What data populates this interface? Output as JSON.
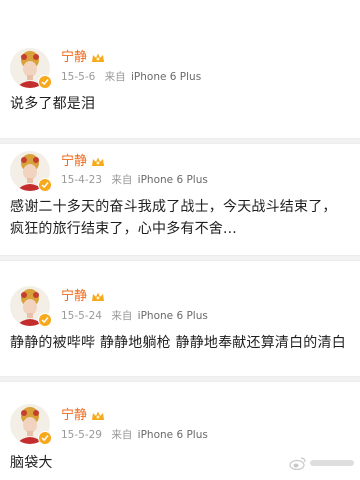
{
  "posts": [
    {
      "name": "宁静",
      "date": "15-5-6",
      "source_prefix": "来自",
      "device": "iPhone 6 Plus",
      "text": "说多了都是泪"
    },
    {
      "name": "宁静",
      "date": "15-4-23",
      "source_prefix": "来自",
      "device": "iPhone 6 Plus",
      "text": "感谢二十多天的奋斗我成了战士，今天战斗结束了，疯狂的旅行结束了，心中多有不舍..."
    },
    {
      "name": "宁静",
      "date": "15-5-24",
      "source_prefix": "来自",
      "device": "iPhone 6 Plus",
      "text": "静静的被哔哔 静静地躺枪 静静地奉献还算清白的清白"
    },
    {
      "name": "宁静",
      "date": "15-5-29",
      "source_prefix": "来自",
      "device": "iPhone 6 Plus",
      "text": "脑袋大"
    }
  ],
  "colors": {
    "name": "#f26a1b",
    "badge": "#f7a81b",
    "meta": "#9a9a9a",
    "separator": "#f2f2f2"
  },
  "icons": {
    "verified": "verified-badge-icon",
    "crown": "vip-crown-icon",
    "watermark": "weibo-logo-icon"
  }
}
